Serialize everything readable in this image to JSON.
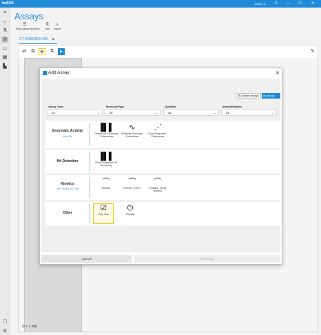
{
  "app": {
    "name": "hoBOS",
    "user": "adam.l.b.",
    "window_controls": [
      "♙",
      "—",
      "☐",
      "✕"
    ]
  },
  "rail": {
    "items": [
      {
        "icon": "menu-icon",
        "glyph": "≡"
      },
      {
        "icon": "home-icon",
        "glyph": "⌂"
      },
      {
        "icon": "flask-icon",
        "glyph": "⚗"
      },
      {
        "icon": "assays-icon",
        "glyph": "▤"
      },
      {
        "icon": "folder-icon",
        "glyph": "▭"
      },
      {
        "icon": "calendar-icon",
        "glyph": "▦"
      },
      {
        "icon": "chart-icon",
        "glyph": "▙"
      }
    ],
    "bottom": [
      {
        "icon": "chat-icon",
        "glyph": "▢"
      },
      {
        "icon": "settings-icon",
        "glyph": "⚙"
      }
    ]
  },
  "header": {
    "title": "Assays",
    "toolbar": [
      {
        "label": "Show Assay Workflow",
        "glyph": "☰"
      },
      {
        "label": "New",
        "glyph": "⎘"
      },
      {
        "label": "Import",
        "glyph": "⭳"
      }
    ]
  },
  "tab": {
    "label": "CT 010504021400",
    "close": "✕"
  },
  "workflow_toolbar": {
    "buttons": [
      {
        "icon": "swap-icon",
        "glyph": "⇄"
      },
      {
        "icon": "copy-icon",
        "glyph": "⧉"
      },
      {
        "icon": "add-circle-icon",
        "glyph": "⊕"
      },
      {
        "icon": "flask-icon",
        "glyph": "⚗"
      },
      {
        "icon": "play-icon",
        "glyph": "▶"
      }
    ],
    "edit_glyph": "✎"
  },
  "timer": {
    "glyph": "⏱",
    "text": "< 1 min"
  },
  "modal": {
    "title": "Add Assay",
    "close": "✕",
    "custom_assays_label": "Custom Assays",
    "assays_label": "Assays",
    "filters": [
      {
        "label": "Assay Type",
        "value": "All"
      },
      {
        "label": "MoleculeType",
        "value": "All"
      },
      {
        "label": "Quantity",
        "value": "All"
      },
      {
        "label": "Immobilization",
        "value": "All"
      }
    ],
    "groups": [
      {
        "name": "Enzymatic Activity",
        "sub": "kcat | kr",
        "assays": [
          {
            "label": "Compound Screening - Polymerase",
            "glyph": "▐▌▌",
            "icon": "bar-chart-icon"
          },
          {
            "label": "Substrate Scouting - Polymerase",
            "glyph": "∿",
            "icon": "trend-icon"
          },
          {
            "label": "Dose Response - Polymerase",
            "glyph": "⋰",
            "icon": "dose-response-icon"
          }
        ]
      },
      {
        "name": "Hit Detection",
        "sub": "",
        "assays": [
          {
            "label": "DNA Compound Hit Screening",
            "glyph": "▐▌▌",
            "icon": "bar-chart-icon"
          }
        ]
      },
      {
        "name": "Kinetics",
        "sub": "kon | koff | kD | kd",
        "assays": [
          {
            "label": "Kinetics",
            "glyph": "⌒",
            "icon": "kinetics-icon"
          },
          {
            "label": "Kinetics - FRET",
            "glyph": "⌒",
            "icon": "kinetics-icon"
          },
          {
            "label": "Kinetics - Weak Binders",
            "glyph": "⌒",
            "icon": "kinetics-icon"
          }
        ]
      },
      {
        "name": "Other",
        "sub": "",
        "assays": [
          {
            "label": "Chip Test",
            "glyph": "☑",
            "icon": "clipboard-check-icon",
            "selected": true
          },
          {
            "label": "Standby",
            "glyph": "⏻",
            "icon": "power-icon"
          }
        ]
      }
    ],
    "cancel_label": "Cancel",
    "add_label": "Add Assay"
  },
  "colors": {
    "accent": "#1f8ad8",
    "highlight": "#f5c400"
  }
}
